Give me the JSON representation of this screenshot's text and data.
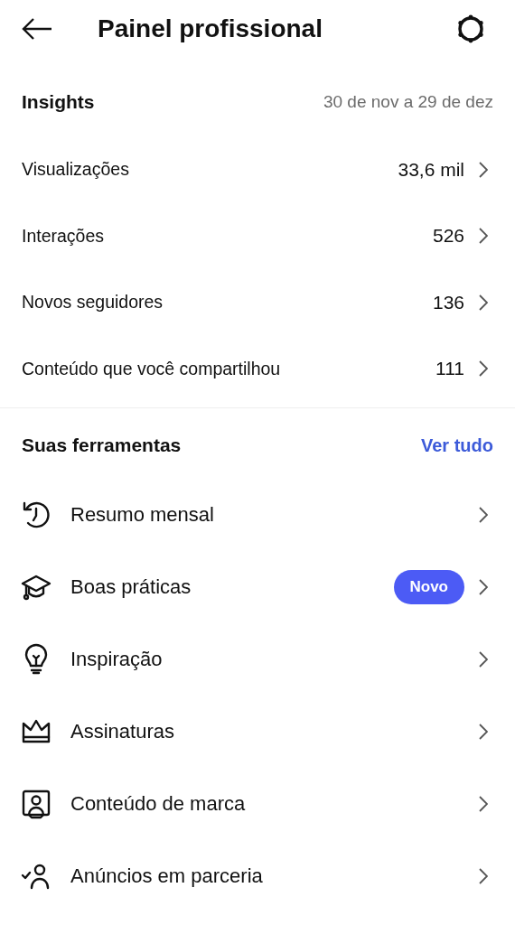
{
  "header": {
    "title": "Painel profissional"
  },
  "insights": {
    "title": "Insights",
    "period": "30 de nov a 29 de dez",
    "rows": [
      {
        "label": "Visualizações",
        "value": "33,6 mil"
      },
      {
        "label": "Interações",
        "value": "526"
      },
      {
        "label": "Novos seguidores",
        "value": "136"
      },
      {
        "label": "Conteúdo que você compartilhou",
        "value": "111"
      }
    ]
  },
  "tools": {
    "title": "Suas ferramentas",
    "link": "Ver tudo",
    "items": [
      {
        "kind": "history",
        "label": "Resumo mensal"
      },
      {
        "kind": "cap",
        "label": "Boas práticas",
        "badge": "Novo"
      },
      {
        "kind": "bulb",
        "label": "Inspiração"
      },
      {
        "kind": "crown",
        "label": "Assinaturas"
      },
      {
        "kind": "portrait",
        "label": "Conteúdo de marca"
      },
      {
        "kind": "person-check",
        "label": "Anúncios em parceria"
      }
    ]
  }
}
